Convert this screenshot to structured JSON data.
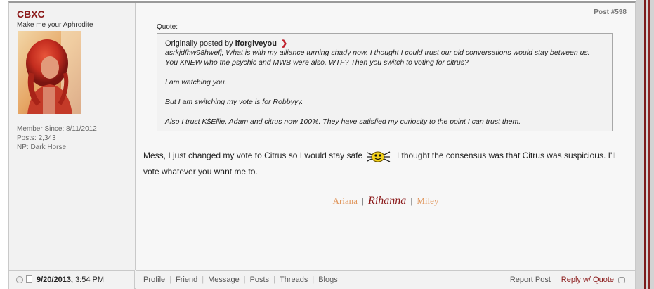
{
  "user": {
    "name": "CBXC",
    "title": "Make me your Aphrodite",
    "member_since": "Member Since: 8/11/2012",
    "posts": "Posts: 2,343",
    "np": "NP: Dark Horse"
  },
  "post": {
    "number": "Post #598",
    "quote_label": "Quote:",
    "quote_originally": "Originally posted by",
    "quote_author": "iforgiveyou",
    "quote_paragraphs": [
      "asrkjdfhw98hwefj; What is with my alliance turning shady now. I thought I could trust our old conversations would stay between us. You KNEW who the psychic and MWB were also. WTF? Then you switch to voting for citrus?",
      "I am watching you.",
      "But I am switching my vote is for Robbyyy.",
      "Also I trust K$Ellie, Adam and citrus now 100%. They have satisfied my curiosity to the point I can trust them."
    ],
    "message_part1": "Mess, I just changed my vote to Citrus so I would stay safe",
    "message_part2": "I thought the consensus was that Citrus was suspicious. I'll vote whatever you want me to.",
    "signature": [
      "Ariana",
      "Rihanna",
      "Miley"
    ],
    "signature_sep": "|"
  },
  "footer": {
    "date": "9/20/2013,",
    "time": "3:54 PM",
    "links": [
      "Profile",
      "Friend",
      "Message",
      "Posts",
      "Threads",
      "Blogs"
    ],
    "report": "Report Post",
    "reply_quote": "Reply w/ Quote"
  },
  "colors": {
    "accent": "#8b1a1a",
    "signature_light": "#e0955a"
  }
}
